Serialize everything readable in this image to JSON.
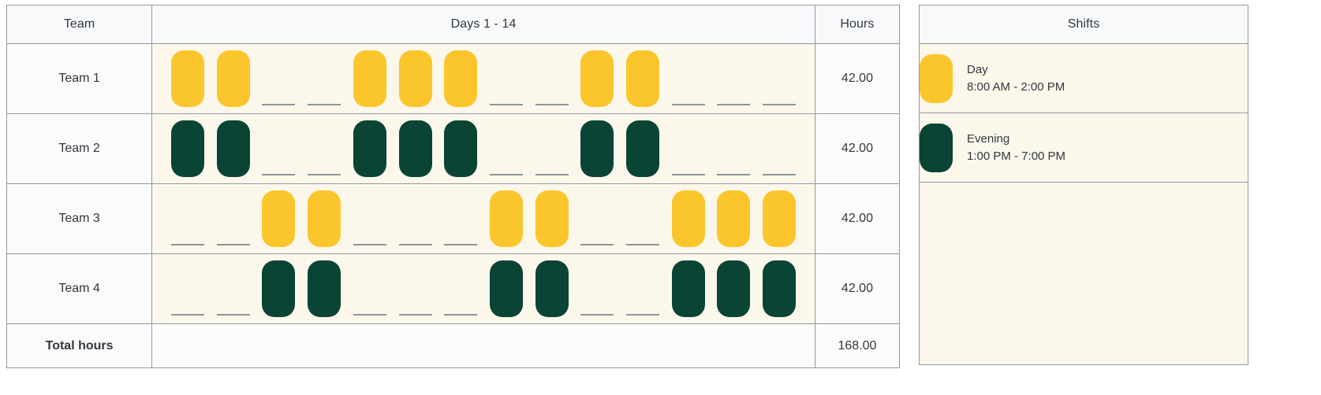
{
  "table": {
    "headers": {
      "team": "Team",
      "days": "Days 1 - 14",
      "hours": "Hours"
    },
    "rows": [
      {
        "team": "Team 1",
        "hours": "42.00",
        "shift_type": "day",
        "days": [
          1,
          1,
          0,
          0,
          1,
          1,
          1,
          0,
          0,
          1,
          1,
          0,
          0,
          0
        ]
      },
      {
        "team": "Team 2",
        "hours": "42.00",
        "shift_type": "evening",
        "days": [
          1,
          1,
          0,
          0,
          1,
          1,
          1,
          0,
          0,
          1,
          1,
          0,
          0,
          0
        ]
      },
      {
        "team": "Team 3",
        "hours": "42.00",
        "shift_type": "day",
        "days": [
          0,
          0,
          1,
          1,
          0,
          0,
          0,
          1,
          1,
          0,
          0,
          1,
          1,
          1
        ]
      },
      {
        "team": "Team 4",
        "hours": "42.00",
        "shift_type": "evening",
        "days": [
          0,
          0,
          1,
          1,
          0,
          0,
          0,
          1,
          1,
          0,
          0,
          1,
          1,
          1
        ]
      }
    ],
    "total": {
      "label": "Total hours",
      "hours": "168.00"
    }
  },
  "shifts_panel": {
    "header": "Shifts",
    "items": [
      {
        "name": "Day",
        "time": "8:00 AM - 2:00 PM",
        "type": "day"
      },
      {
        "name": "Evening",
        "time": "1:00 PM - 7:00 PM",
        "type": "evening"
      }
    ]
  },
  "colors": {
    "day_shift": "#fbc62b",
    "evening_shift": "#0a4435",
    "row_background": "#fbf7eb",
    "header_background": "#f8f9fa",
    "border": "#9199a1",
    "text": "#32383e",
    "dash": "#8e959b"
  }
}
